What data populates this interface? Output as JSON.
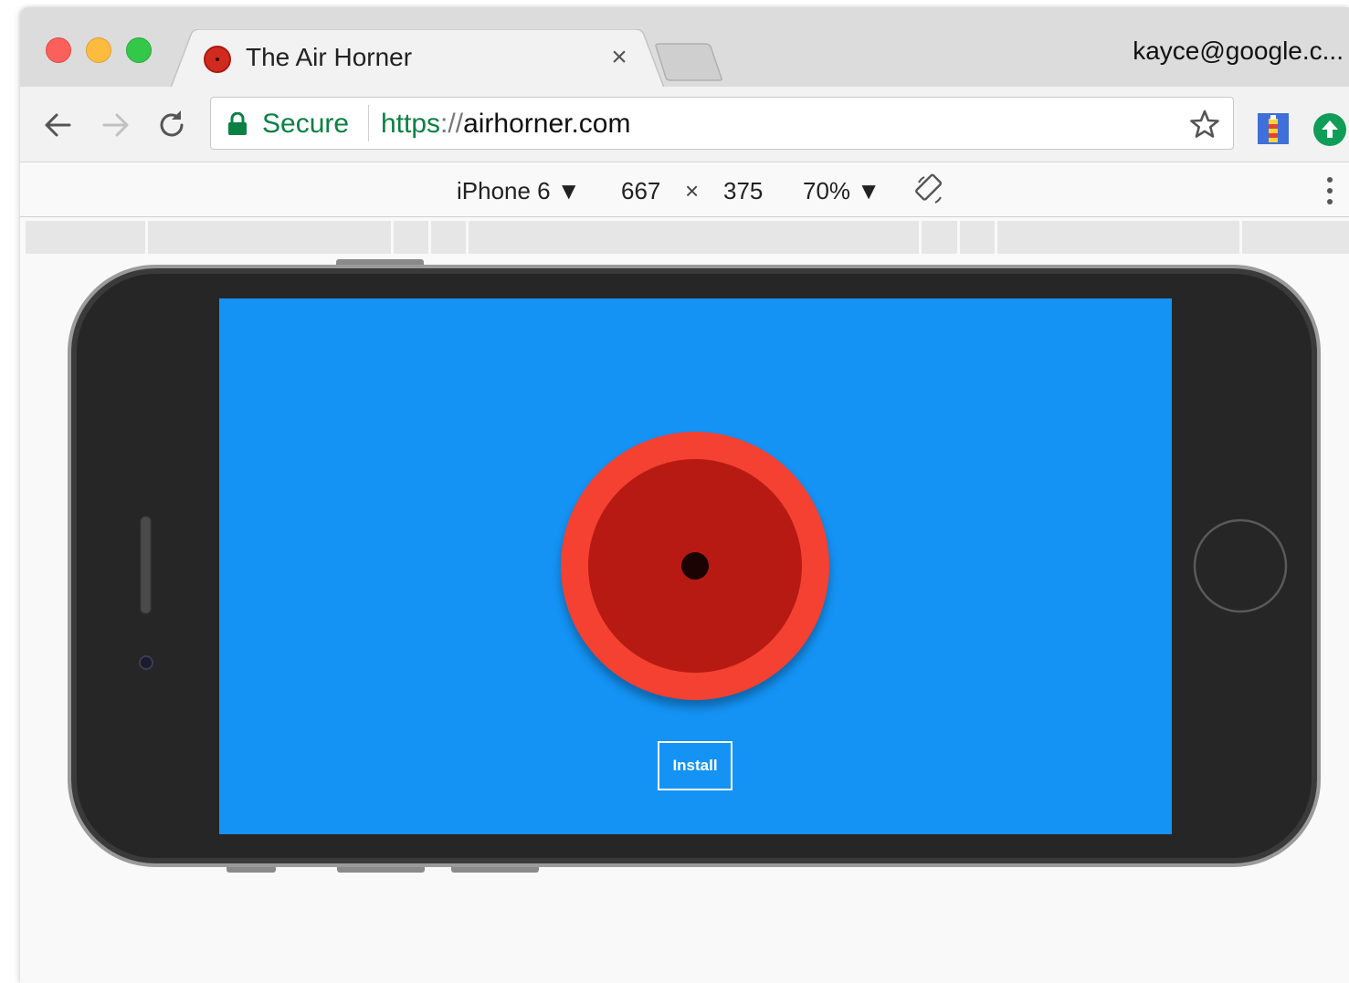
{
  "tab": {
    "title": "The Air Horner",
    "close_glyph": "×"
  },
  "profile": {
    "label": "kayce@google.c..."
  },
  "omnibox": {
    "secure_label": "Secure",
    "url_scheme": "https",
    "url_separator": "://",
    "url_host": "airhorner.com"
  },
  "device_toolbar": {
    "device": "iPhone 6 ▼",
    "width": "667",
    "times": "×",
    "height": "375",
    "zoom": "70% ▼"
  },
  "page": {
    "install_label": "Install"
  },
  "colors": {
    "screen_bg": "#1493f5",
    "horn_outer": "#f44131",
    "horn_inner": "#b71a13",
    "secure_green": "#0b8043"
  },
  "icons": [
    "close-icon",
    "back-icon",
    "forward-icon",
    "reload-icon",
    "lock-icon",
    "star-icon",
    "lighthouse-icon",
    "upload-icon",
    "rotate-icon",
    "more-vert-icon"
  ]
}
